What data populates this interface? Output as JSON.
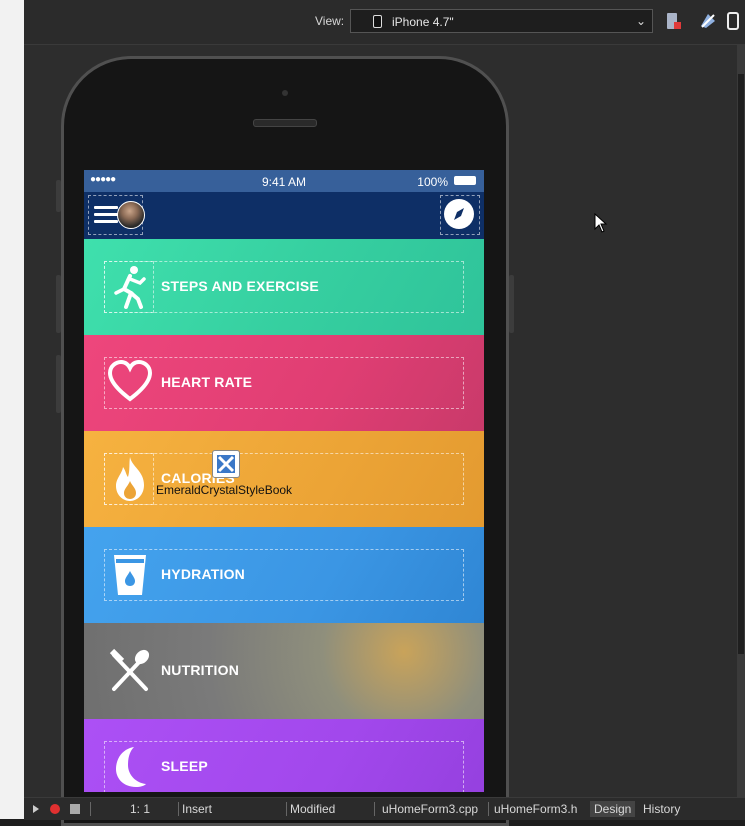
{
  "toolbar": {
    "view_label": "View:",
    "view_value": "iPhone 4.7\""
  },
  "phone": {
    "status": {
      "signal": "●●●●● ",
      "time": "9:41 AM",
      "battery": "100%"
    },
    "rows": [
      {
        "label": "STEPS AND EXERCISE",
        "color": "#3dd9a6",
        "icon": "running-icon"
      },
      {
        "label": "HEART RATE",
        "color": "#e84476",
        "icon": "heart-icon"
      },
      {
        "label": "CALORIES",
        "color": "#f2a93a",
        "icon": "flame-icon"
      },
      {
        "label": "HYDRATION",
        "color": "#3d9be9",
        "icon": "water-glass-icon"
      },
      {
        "label": "NUTRITION",
        "color": "#7e7f7f",
        "icon": "fork-spoon-icon"
      },
      {
        "label": "SLEEP",
        "color": "#a64bf0",
        "icon": "moon-icon"
      }
    ],
    "overlay_component": "EmeraldCrystalStyleBook"
  },
  "statusbar": {
    "position": "1:  1",
    "mode": "Insert",
    "state": "Modified",
    "tabs": [
      "uHomeForm3.cpp",
      "uHomeForm3.h",
      "Design",
      "History"
    ],
    "active_tab": "Design"
  }
}
